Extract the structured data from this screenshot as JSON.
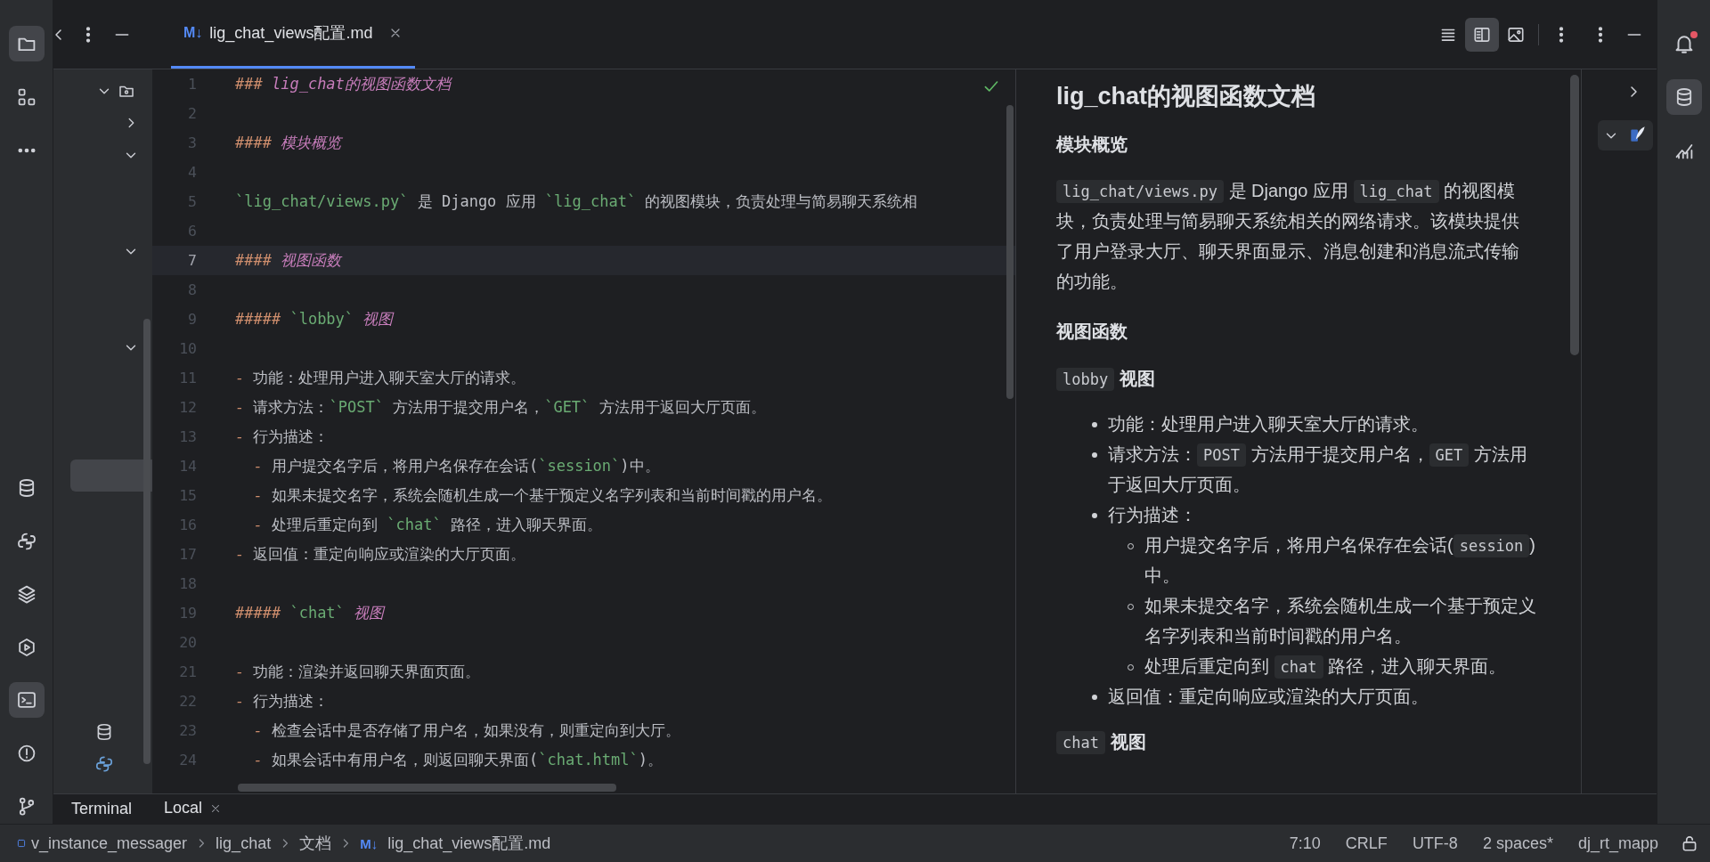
{
  "left_tools_top": [
    {
      "kind": "folder",
      "selected": true
    },
    {
      "kind": "structure",
      "selected": false
    },
    {
      "kind": "more",
      "selected": false
    }
  ],
  "left_tools_bottom": [
    {
      "kind": "database",
      "selected": false
    },
    {
      "kind": "python",
      "selected": false
    },
    {
      "kind": "layers",
      "selected": false
    },
    {
      "kind": "run",
      "selected": false
    },
    {
      "kind": "terminal",
      "selected": true
    },
    {
      "kind": "problems",
      "selected": false
    },
    {
      "kind": "git",
      "selected": false
    }
  ],
  "toolbar": {
    "tab": {
      "badge": "M↓",
      "label": "lig_chat_views配置.md",
      "selected": true
    },
    "editor_modes": [
      {
        "kind": "code",
        "selected": false
      },
      {
        "kind": "split",
        "selected": true
      },
      {
        "kind": "preview",
        "selected": false
      }
    ]
  },
  "right_tools": [
    {
      "kind": "database",
      "selected": true
    },
    {
      "kind": "chart",
      "selected": false
    }
  ],
  "project_tree": {
    "items": [
      {
        "kind": "root-folder",
        "expanded": true
      },
      {
        "kind": "folder",
        "expanded": false
      },
      {
        "kind": "folder",
        "expanded": true
      },
      {
        "kind": "hidden",
        "selected": false
      },
      {
        "kind": "hidden",
        "selected": false
      },
      {
        "kind": "folder",
        "expanded": true
      },
      {
        "kind": "hidden",
        "selected": false
      },
      {
        "kind": "hidden",
        "selected": false
      },
      {
        "kind": "folder",
        "expanded": true
      },
      {
        "kind": "hidden",
        "selected": false
      },
      {
        "kind": "hidden",
        "selected": false
      },
      {
        "kind": "hidden",
        "selected": false
      },
      {
        "kind": "hidden",
        "selected": true
      },
      {
        "kind": "hidden",
        "selected": false
      },
      {
        "kind": "hidden",
        "selected": false
      },
      {
        "kind": "hidden",
        "selected": false
      },
      {
        "kind": "hidden",
        "selected": false
      },
      {
        "kind": "hidden",
        "selected": false
      },
      {
        "kind": "hidden",
        "selected": false
      },
      {
        "kind": "hidden",
        "selected": false
      },
      {
        "kind": "database-file"
      },
      {
        "kind": "python-file"
      }
    ]
  },
  "editor": {
    "lines": [
      {
        "number": "1",
        "current": false,
        "segments": [
          {
            "kind": "mark",
            "text": "### "
          },
          {
            "kind": "heading",
            "text": "lig_chat的视图函数文档"
          }
        ]
      },
      {
        "number": "2",
        "current": false
      },
      {
        "number": "3",
        "current": false,
        "segments": [
          {
            "kind": "mark",
            "text": "#### "
          },
          {
            "kind": "heading",
            "text": "模块概览"
          }
        ]
      },
      {
        "number": "4",
        "current": false
      },
      {
        "number": "5",
        "current": false,
        "segments": [
          {
            "kind": "code",
            "text": "`lig_chat/views.py`"
          },
          {
            "kind": "text",
            "text": " 是 Django 应用 "
          },
          {
            "kind": "code",
            "text": "`lig_chat`"
          },
          {
            "kind": "text",
            "text": " 的视图模块，负责处理与简易聊天系统相"
          }
        ]
      },
      {
        "number": "6",
        "current": false
      },
      {
        "number": "7",
        "current": true,
        "segments": [
          {
            "kind": "mark",
            "text": "#### "
          },
          {
            "kind": "heading",
            "text": "视图函数"
          }
        ]
      },
      {
        "number": "8",
        "current": false
      },
      {
        "number": "9",
        "current": false,
        "segments": [
          {
            "kind": "mark",
            "text": "##### "
          },
          {
            "kind": "code",
            "text": "`lobby`"
          },
          {
            "kind": "heading",
            "text": " 视图"
          }
        ]
      },
      {
        "number": "10",
        "current": false
      },
      {
        "number": "11",
        "current": false,
        "segments": [
          {
            "kind": "mark",
            "text": "- "
          },
          {
            "kind": "text",
            "text": "功能：处理用户进入聊天室大厅的请求。"
          }
        ]
      },
      {
        "number": "12",
        "current": false,
        "segments": [
          {
            "kind": "mark",
            "text": "- "
          },
          {
            "kind": "text",
            "text": "请求方法："
          },
          {
            "kind": "code",
            "text": "`POST`"
          },
          {
            "kind": "text",
            "text": " 方法用于提交用户名，"
          },
          {
            "kind": "code",
            "text": "`GET`"
          },
          {
            "kind": "text",
            "text": " 方法用于返回大厅页面。"
          }
        ]
      },
      {
        "number": "13",
        "current": false,
        "segments": [
          {
            "kind": "mark",
            "text": "- "
          },
          {
            "kind": "text",
            "text": "行为描述："
          }
        ]
      },
      {
        "number": "14",
        "current": false,
        "segments": [
          {
            "kind": "mark",
            "text": "  - "
          },
          {
            "kind": "text",
            "text": "用户提交名字后，将用户名保存在会话("
          },
          {
            "kind": "code",
            "text": "`session`"
          },
          {
            "kind": "text",
            "text": ")中。"
          }
        ]
      },
      {
        "number": "15",
        "current": false,
        "segments": [
          {
            "kind": "mark",
            "text": "  - "
          },
          {
            "kind": "text",
            "text": "如果未提交名字，系统会随机生成一个基于预定义名字列表和当前时间戳的用户名。"
          }
        ]
      },
      {
        "number": "16",
        "current": false,
        "segments": [
          {
            "kind": "mark",
            "text": "  - "
          },
          {
            "kind": "text",
            "text": "处理后重定向到 "
          },
          {
            "kind": "code",
            "text": "`chat`"
          },
          {
            "kind": "text",
            "text": " 路径，进入聊天界面。"
          }
        ]
      },
      {
        "number": "17",
        "current": false,
        "segments": [
          {
            "kind": "mark",
            "text": "- "
          },
          {
            "kind": "text",
            "text": "返回值：重定向响应或渲染的大厅页面。"
          }
        ]
      },
      {
        "number": "18",
        "current": false
      },
      {
        "number": "19",
        "current": false,
        "segments": [
          {
            "kind": "mark",
            "text": "##### "
          },
          {
            "kind": "code",
            "text": "`chat`"
          },
          {
            "kind": "heading",
            "text": " 视图"
          }
        ]
      },
      {
        "number": "20",
        "current": false
      },
      {
        "number": "21",
        "current": false,
        "segments": [
          {
            "kind": "mark",
            "text": "- "
          },
          {
            "kind": "text",
            "text": "功能：渲染并返回聊天界面页面。"
          }
        ]
      },
      {
        "number": "22",
        "current": false,
        "segments": [
          {
            "kind": "mark",
            "text": "- "
          },
          {
            "kind": "text",
            "text": "行为描述："
          }
        ]
      },
      {
        "number": "23",
        "current": false,
        "segments": [
          {
            "kind": "mark",
            "text": "  - "
          },
          {
            "kind": "text",
            "text": "检查会话中是否存储了用户名，如果没有，则重定向到大厅。"
          }
        ]
      },
      {
        "number": "24",
        "current": false,
        "segments": [
          {
            "kind": "mark",
            "text": "  - "
          },
          {
            "kind": "text",
            "text": "如果会话中有用户名，则返回聊天界面("
          },
          {
            "kind": "code",
            "text": "`chat.html`"
          },
          {
            "kind": "text",
            "text": ")。"
          }
        ]
      }
    ]
  },
  "preview": {
    "blocks": [
      {
        "kind": "h1",
        "parts": [
          {
            "kind": "text",
            "text": "lig_chat的视图函数文档"
          }
        ]
      },
      {
        "kind": "h2",
        "parts": [
          {
            "kind": "text",
            "text": "模块概览"
          }
        ]
      },
      {
        "kind": "p",
        "parts": [
          {
            "kind": "code",
            "text": "lig_chat/views.py"
          },
          {
            "kind": "text",
            "text": " 是 Django 应用 "
          },
          {
            "kind": "code",
            "text": "lig_chat"
          },
          {
            "kind": "text",
            "text": " 的视图模块，负责处理与简易聊天系统相关的网络请求。该模块提供了用户登录大厅、聊天界面显示、消息创建和消息流式传输的功能。"
          }
        ]
      },
      {
        "kind": "h2",
        "parts": [
          {
            "kind": "text",
            "text": "视图函数"
          }
        ]
      },
      {
        "kind": "h3",
        "parts": [
          {
            "kind": "code",
            "text": "lobby"
          },
          {
            "kind": "text",
            "text": " 视图"
          }
        ]
      },
      {
        "kind": "ul",
        "items": [
          {
            "parts": [
              {
                "kind": "text",
                "text": "功能：处理用户进入聊天室大厅的请求。"
              }
            ]
          },
          {
            "parts": [
              {
                "kind": "text",
                "text": "请求方法："
              },
              {
                "kind": "code",
                "text": "POST"
              },
              {
                "kind": "text",
                "text": " 方法用于提交用户名，"
              },
              {
                "kind": "code",
                "text": "GET"
              },
              {
                "kind": "text",
                "text": " 方法用于返回大厅页面。"
              }
            ]
          },
          {
            "parts": [
              {
                "kind": "text",
                "text": "行为描述："
              }
            ],
            "children": [
              {
                "parts": [
                  {
                    "kind": "text",
                    "text": "用户提交名字后，将用户名保存在会话("
                  },
                  {
                    "kind": "code",
                    "text": "session"
                  },
                  {
                    "kind": "text",
                    "text": ")中。"
                  }
                ]
              },
              {
                "parts": [
                  {
                    "kind": "text",
                    "text": "如果未提交名字，系统会随机生成一个基于预定义名字列表和当前时间戳的用户名。"
                  }
                ]
              },
              {
                "parts": [
                  {
                    "kind": "text",
                    "text": "处理后重定向到 "
                  },
                  {
                    "kind": "code",
                    "text": "chat"
                  },
                  {
                    "kind": "text",
                    "text": " 路径，进入聊天界面。"
                  }
                ]
              }
            ]
          },
          {
            "parts": [
              {
                "kind": "text",
                "text": "返回值：重定向响应或渲染的大厅页面。"
              }
            ]
          }
        ]
      },
      {
        "kind": "h3",
        "parts": [
          {
            "kind": "code",
            "text": "chat"
          },
          {
            "kind": "text",
            "text": " 视图"
          }
        ]
      }
    ]
  },
  "terminal": {
    "title": "Terminal",
    "tabs": [
      {
        "label": "Local",
        "selected": true
      }
    ]
  },
  "status_bar": {
    "breadcrumbs": [
      {
        "kind": "module",
        "text": "v_instance_messager"
      },
      {
        "kind": "plain",
        "text": "lig_chat"
      },
      {
        "kind": "plain",
        "text": "文档"
      },
      {
        "kind": "markdown",
        "badge": "M↓",
        "text": "lig_chat_views配置.md"
      }
    ],
    "items": [
      "7:10",
      "CRLF",
      "UTF-8",
      "2 spaces*",
      "dj_rt_mapp"
    ]
  }
}
